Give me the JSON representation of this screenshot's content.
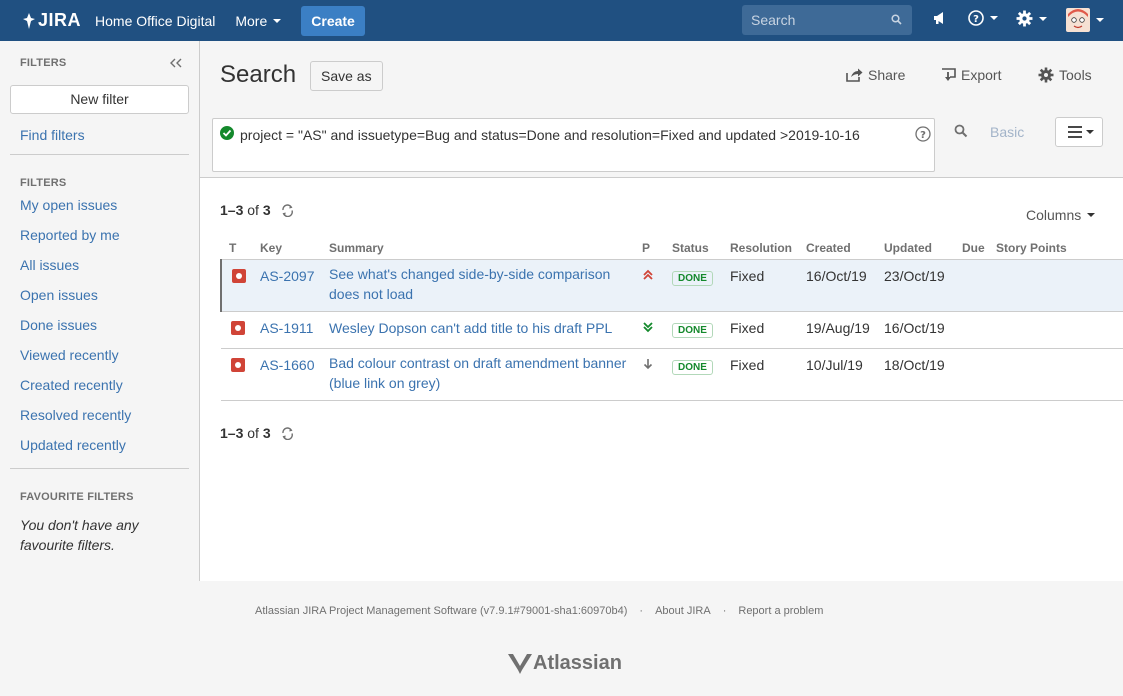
{
  "header": {
    "app_name": "JIRA",
    "project": "Home Office Digital",
    "more_label": "More",
    "create_label": "Create",
    "search_placeholder": "Search"
  },
  "sidebar": {
    "filters_heading": "FILTERS",
    "new_filter_label": "New filter",
    "find_filters_label": "Find filters",
    "filters_heading_2": "FILTERS",
    "items": [
      {
        "label": "My open issues"
      },
      {
        "label": "Reported by me"
      },
      {
        "label": "All issues"
      },
      {
        "label": "Open issues"
      },
      {
        "label": "Done issues"
      },
      {
        "label": "Viewed recently"
      },
      {
        "label": "Created recently"
      },
      {
        "label": "Resolved recently"
      },
      {
        "label": "Updated recently"
      }
    ],
    "favourite_heading": "FAVOURITE FILTERS",
    "favourite_empty": "You don't have any favourite filters."
  },
  "main": {
    "title": "Search",
    "save_as_label": "Save as",
    "share_label": "Share",
    "export_label": "Export",
    "tools_label": "Tools",
    "jql": "project = \"AS\" and issuetype=Bug and status=Done and resolution=Fixed and updated >2019-10-16",
    "basic_label": "Basic",
    "count": {
      "range": "1–3",
      "of": "of",
      "total": "3"
    },
    "columns_label": "Columns",
    "table": {
      "headers": [
        "T",
        "Key",
        "Summary",
        "P",
        "Status",
        "Resolution",
        "Created",
        "Updated",
        "Due",
        "Story Points"
      ],
      "rows": [
        {
          "key": "AS-2097",
          "summary_1": "See what's changed side-by-side comparison",
          "summary_2": "does not load",
          "priority": "highest",
          "status": "DONE",
          "resolution": "Fixed",
          "created": "16/Oct/19",
          "updated": "23/Oct/19",
          "due": "",
          "points": ""
        },
        {
          "key": "AS-1911",
          "summary_1": "Wesley Dopson can't add title to his draft PPL",
          "summary_2": "",
          "priority": "lowest",
          "status": "DONE",
          "resolution": "Fixed",
          "created": "19/Aug/19",
          "updated": "16/Oct/19",
          "due": "",
          "points": ""
        },
        {
          "key": "AS-1660",
          "summary_1": "Bad colour contrast on draft amendment banner",
          "summary_2": "(blue link on grey)",
          "priority": "low",
          "status": "DONE",
          "resolution": "Fixed",
          "created": "10/Jul/19",
          "updated": "18/Oct/19",
          "due": "",
          "points": ""
        }
      ]
    }
  },
  "footer": {
    "software": "Atlassian JIRA Project Management Software (v7.9.1#79001-sha1:60970b4)",
    "about": "About JIRA",
    "report": "Report a problem",
    "logo_text": "Atlassian"
  },
  "colors": {
    "header_bg": "#205081",
    "link": "#3b73af",
    "done_green": "#14892c",
    "bug_red": "#d04437"
  }
}
